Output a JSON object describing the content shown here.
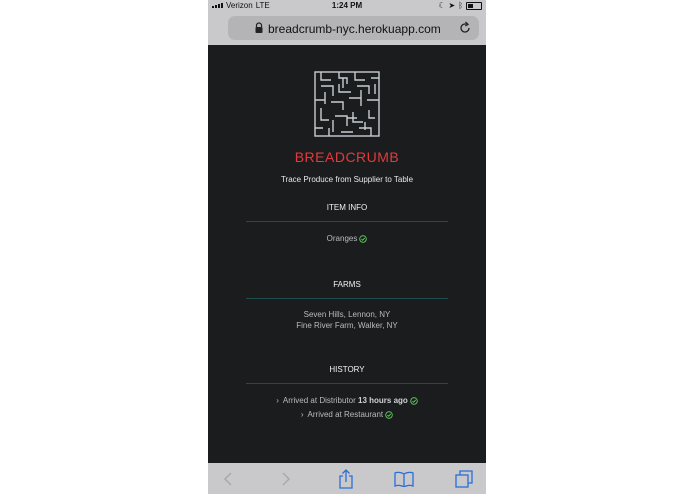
{
  "status": {
    "carrier": "Verizon",
    "network": "LTE",
    "time": "1:24 PM"
  },
  "browser": {
    "url": "breadcrumb-nyc.herokuapp.com"
  },
  "app": {
    "brand": "BREADCRUMB",
    "tagline": "Trace Produce from Supplier to Table"
  },
  "item_info": {
    "heading": "ITEM INFO",
    "item": "Oranges"
  },
  "farms": {
    "heading": "FARMS",
    "list": [
      "Seven Hills, Lennon, NY",
      "Fine River Farm, Walker, NY"
    ]
  },
  "history": {
    "heading": "HISTORY",
    "events": [
      {
        "label": "Arrived at Distributor",
        "time": "13 hours ago"
      },
      {
        "label": "Arrived at Restaurant",
        "time": ""
      }
    ]
  },
  "colors": {
    "brand": "#e23a3e",
    "check": "#5fd05f",
    "background": "#1b1c1e",
    "divider": "#1d4c4a"
  },
  "icons": [
    "lock-icon",
    "reload-icon",
    "maze-logo-icon",
    "check-circle-icon",
    "chevron-right-icon",
    "back-icon",
    "forward-icon",
    "share-icon",
    "bookmarks-icon",
    "tabs-icon"
  ]
}
